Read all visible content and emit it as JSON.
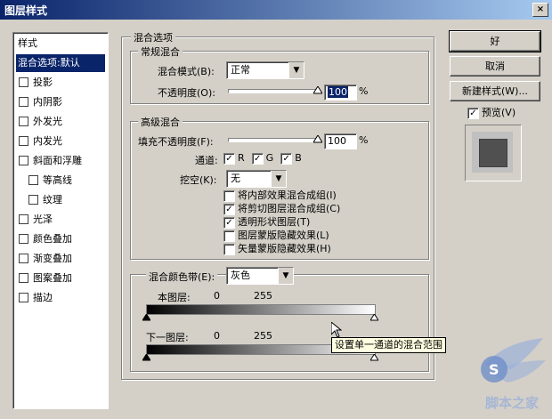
{
  "window": {
    "title": "图层样式",
    "close": "×"
  },
  "sidebar": {
    "header": "样式",
    "items": [
      {
        "label": "混合选项:默认",
        "checkbox": false,
        "selected": true,
        "indent": false
      },
      {
        "label": "投影",
        "checkbox": true
      },
      {
        "label": "内阴影",
        "checkbox": true
      },
      {
        "label": "外发光",
        "checkbox": true
      },
      {
        "label": "内发光",
        "checkbox": true
      },
      {
        "label": "斜面和浮雕",
        "checkbox": true
      },
      {
        "label": "等高线",
        "checkbox": true,
        "indent": true
      },
      {
        "label": "纹理",
        "checkbox": true,
        "indent": true
      },
      {
        "label": "光泽",
        "checkbox": true
      },
      {
        "label": "颜色叠加",
        "checkbox": true
      },
      {
        "label": "渐变叠加",
        "checkbox": true
      },
      {
        "label": "图案叠加",
        "checkbox": true
      },
      {
        "label": "描边",
        "checkbox": true
      }
    ]
  },
  "blend_options": {
    "title": "混合选项",
    "general": {
      "title": "常规混合",
      "mode_label": "混合模式(B):",
      "mode_value": "正常",
      "opacity_label": "不透明度(O):",
      "opacity_value": "100",
      "opacity_unit": "%"
    },
    "advanced": {
      "title": "高级混合",
      "fill_label": "填充不透明度(F):",
      "fill_value": "100",
      "fill_unit": "%",
      "channels_label": "通道:",
      "channels": [
        {
          "label": "R",
          "checked": true
        },
        {
          "label": "G",
          "checked": true
        },
        {
          "label": "B",
          "checked": true
        }
      ],
      "knockout_label": "挖空(K):",
      "knockout_value": "无",
      "options": [
        {
          "label": "将内部效果混合成组(I)",
          "checked": false
        },
        {
          "label": "将剪切图层混合成组(C)",
          "checked": true
        },
        {
          "label": "透明形状图层(T)",
          "checked": true
        },
        {
          "label": "图层蒙版隐藏效果(L)",
          "checked": false
        },
        {
          "label": "矢量蒙版隐藏效果(H)",
          "checked": false
        }
      ]
    },
    "blend_if": {
      "label": "混合颜色带(E):",
      "value": "灰色",
      "this_layer_label": "本图层:",
      "this_layer_min": "0",
      "this_layer_max": "255",
      "under_layer_label": "下一图层:",
      "under_layer_min": "0",
      "under_layer_max": "255",
      "tooltip": "设置单一通道的混合范围"
    }
  },
  "buttons": {
    "ok": "好",
    "cancel": "取消",
    "new_style": "新建样式(W)...",
    "preview_label": "预览(V)",
    "preview_checked": true
  },
  "watermark": {
    "text": "脚本之家",
    "site": "S"
  },
  "colors": {
    "titlebar": "#0a246a",
    "selection": "#0a246a",
    "face": "#d4d0c8"
  }
}
